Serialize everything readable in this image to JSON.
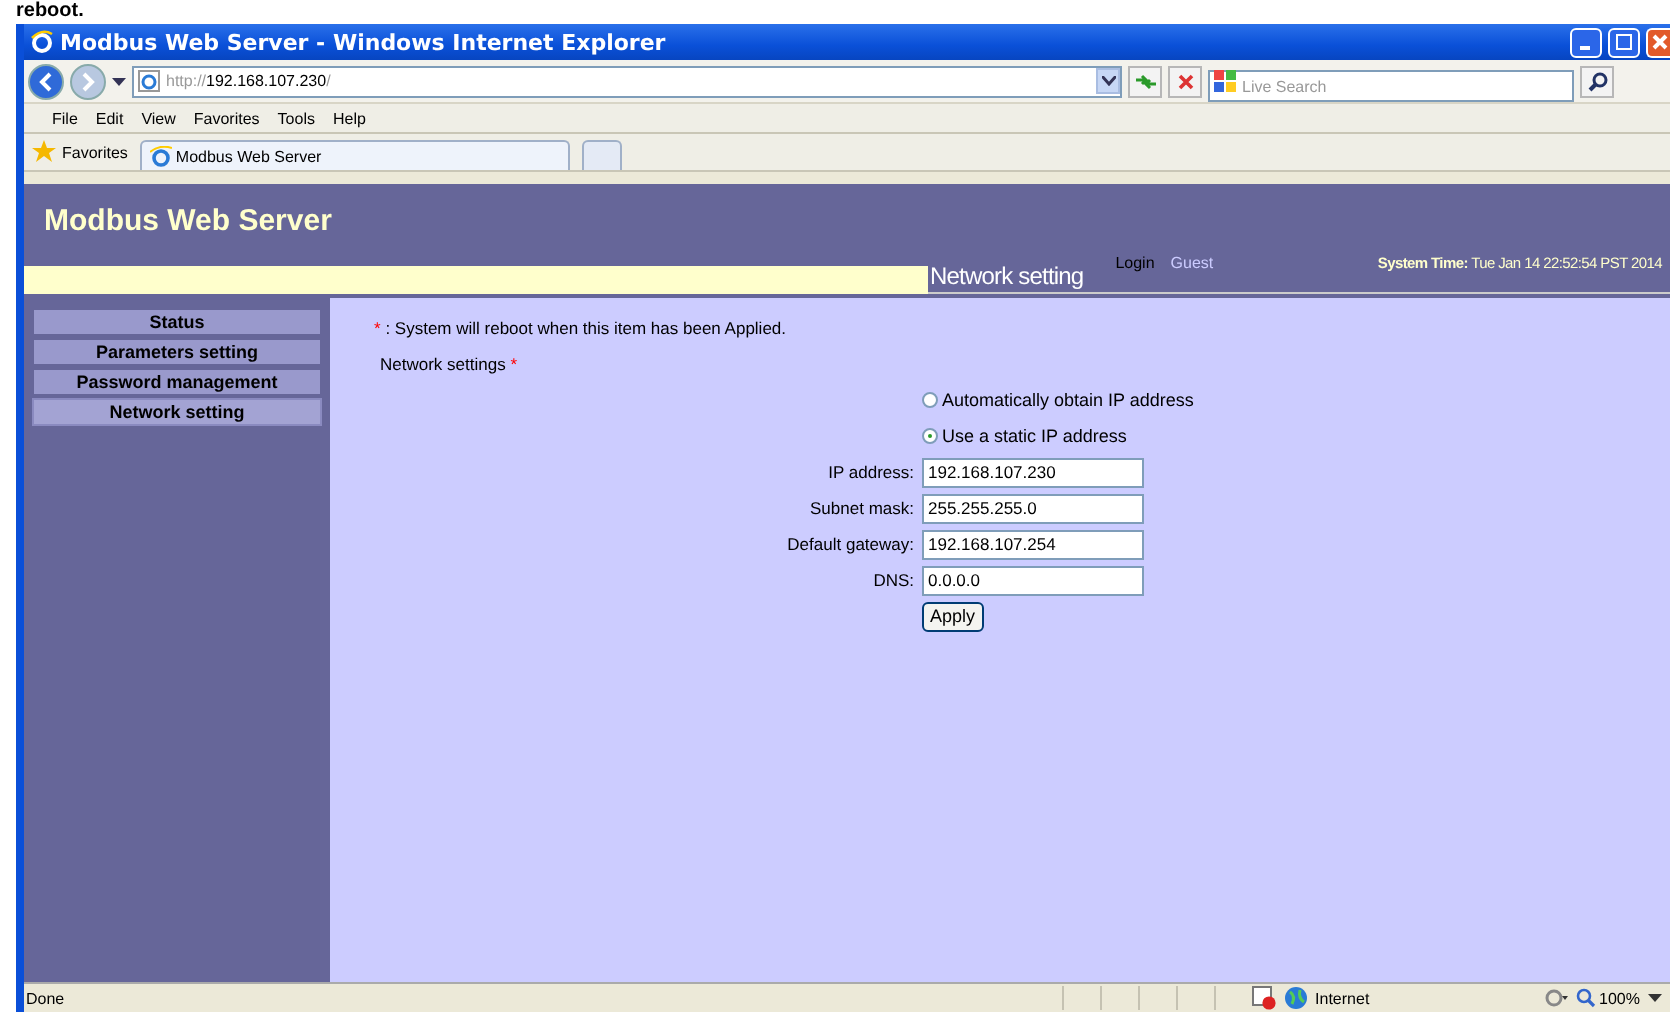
{
  "caption": "reboot.",
  "window": {
    "title": "Modbus Web Server - Windows Internet Explorer"
  },
  "address_bar": {
    "url_prefix": "http://",
    "url_host": "192.168.107.230",
    "url_suffix": "/",
    "search_placeholder": "Live Search"
  },
  "menu": [
    "File",
    "Edit",
    "View",
    "Favorites",
    "Tools",
    "Help"
  ],
  "favorites_bar": {
    "label": "Favorites",
    "tabs": [
      {
        "label": "Modbus Web Server",
        "selected": true
      },
      {
        "selected": false
      }
    ]
  },
  "page": {
    "site_title": "Modbus Web Server",
    "section_title": "Network setting",
    "login_label": "Login",
    "user": "Guest",
    "system_time_label": "System Time:",
    "system_time": "Tue Jan 14 22:52:54 PST 2014",
    "sidebar": [
      {
        "label": "Status",
        "selected": false
      },
      {
        "label": "Parameters setting",
        "selected": false
      },
      {
        "label": "Password management",
        "selected": false
      },
      {
        "label": "Network setting",
        "selected": true
      }
    ],
    "note_mark": "*",
    "note": ": System will reboot when this item has been Applied.",
    "group_label": "Network settings",
    "group_mark": "*",
    "radios": [
      {
        "label": "Automatically obtain IP address",
        "selected": false
      },
      {
        "label": "Use a static IP address",
        "selected": true
      }
    ],
    "fields": [
      {
        "label": "IP address:",
        "value": "192.168.107.230"
      },
      {
        "label": "Subnet mask:",
        "value": "255.255.255.0"
      },
      {
        "label": "Default gateway:",
        "value": "192.168.107.254"
      },
      {
        "label": "DNS:",
        "value": "0.0.0.0"
      }
    ],
    "apply_button": "Apply"
  },
  "status_bar": {
    "text": "Done",
    "zone": "Internet",
    "zoom": "100%"
  }
}
